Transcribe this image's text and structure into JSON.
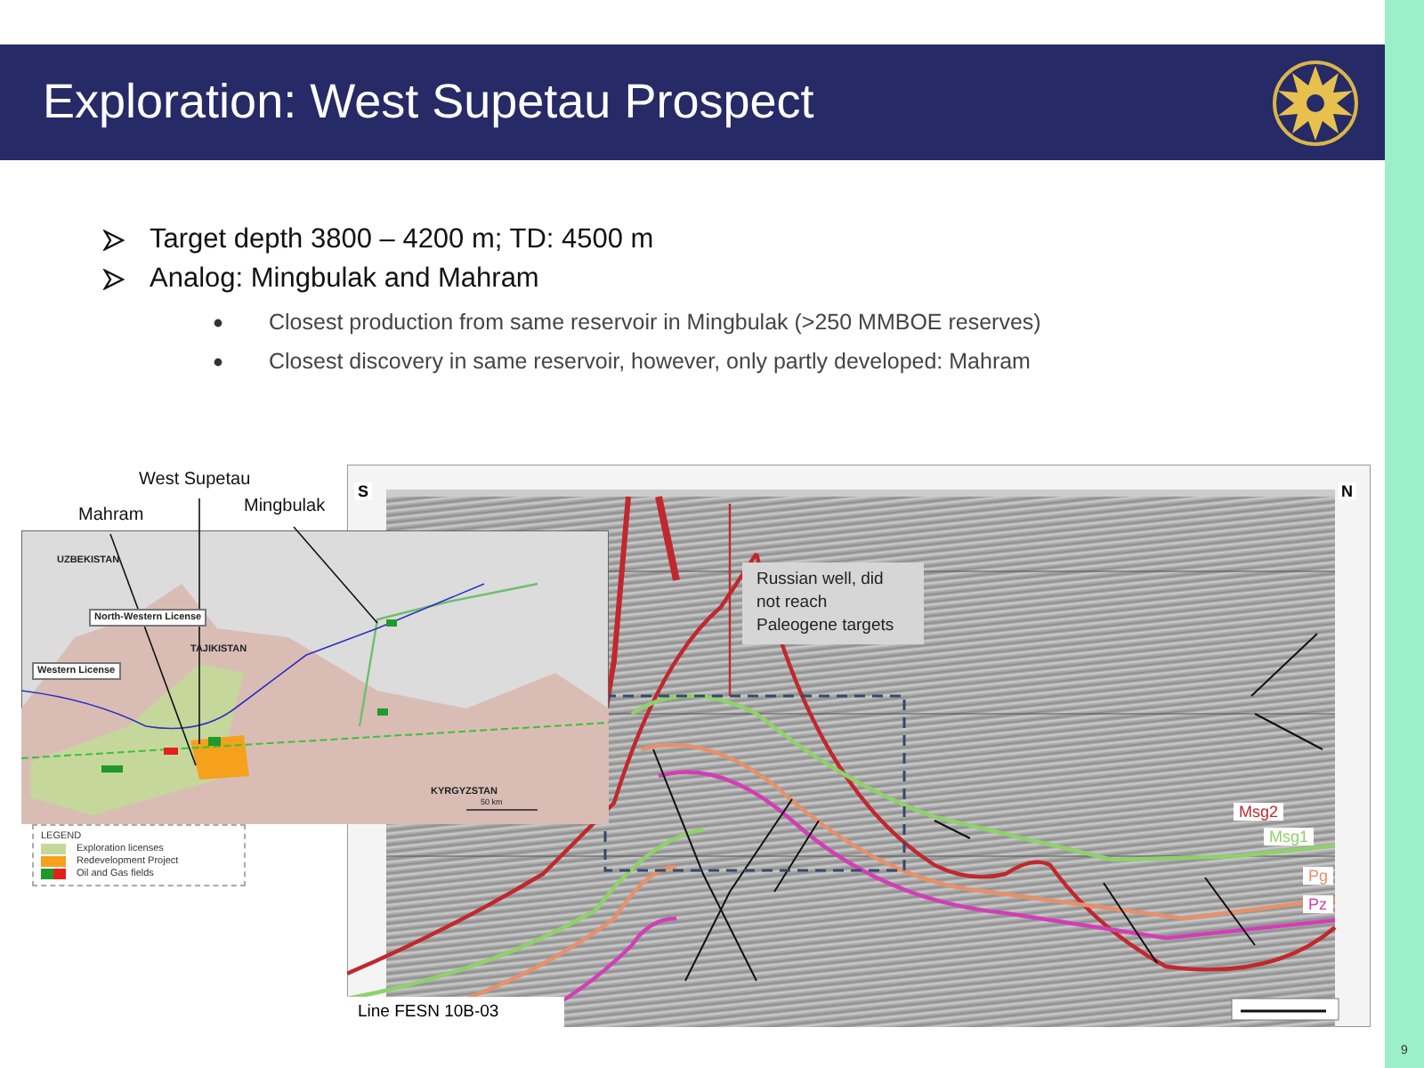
{
  "header": {
    "title": "Exploration: West Supetau Prospect"
  },
  "bullets": [
    {
      "text": "Target depth 3800 – 4200 m; TD: 4500 m"
    },
    {
      "text": "Analog: Mingbulak and Mahram",
      "children": [
        {
          "text": "Closest production from same reservoir in Mingbulak (>250 MMBOE reserves)"
        },
        {
          "text": "Closest discovery in same reservoir, however, only partly developed: Mahram"
        }
      ]
    }
  ],
  "map": {
    "callouts": [
      {
        "text": "West Supetau"
      },
      {
        "text": "Mahram"
      },
      {
        "text": "Mingbulak"
      }
    ],
    "labels": [
      {
        "text": "UZBEKISTAN",
        "kind": "country"
      },
      {
        "text": "North-Western License",
        "kind": "license"
      },
      {
        "text": "TAJIKISTAN",
        "kind": "country"
      },
      {
        "text": "Western License",
        "kind": "license"
      },
      {
        "text": "KYRGYZSTAN",
        "kind": "country"
      }
    ],
    "scale": "50 km",
    "legend": {
      "title": "LEGEND",
      "items": [
        {
          "label": "Exploration licenses",
          "swatches": [
            {
              "color": "#c6d79c"
            }
          ]
        },
        {
          "label": "Redevelopment Project",
          "swatches": [
            {
              "color": "#f5a11c"
            }
          ]
        },
        {
          "label": "Oil and Gas fields",
          "swatches": [
            {
              "color": "#1e9a2a"
            },
            {
              "color": "#e3201b"
            }
          ]
        }
      ]
    }
  },
  "seismic": {
    "south": "S",
    "north": "N",
    "note": "Russian well, did not reach Paleogene targets",
    "line_name": "Line FESN 10B-03",
    "horizons": [
      {
        "name": "Msg2",
        "color": "#c0282d"
      },
      {
        "name": "Msg1",
        "color": "#8fd16a"
      },
      {
        "name": "Pg",
        "color": "#e8906a"
      },
      {
        "name": "Pz",
        "color": "#d13fb4"
      }
    ]
  },
  "page_number": "9"
}
